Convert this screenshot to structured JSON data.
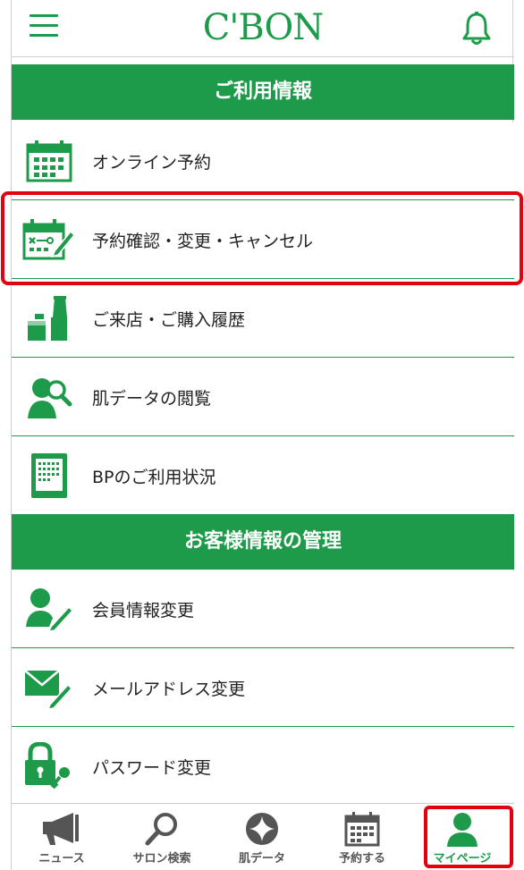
{
  "header": {
    "logo": "C'BON",
    "menu_icon": "hamburger-icon",
    "notification_icon": "bell-icon"
  },
  "sections": {
    "usage": {
      "title": "ご利用情報"
    },
    "customer": {
      "title": "お客様情報の管理"
    }
  },
  "usage_items": [
    {
      "label": "オンライン予約",
      "icon": "calendar-icon"
    },
    {
      "label": "予約確認・変更・キャンセル",
      "icon": "calendar-edit-icon"
    },
    {
      "label": "ご来店・ご購入履歴",
      "icon": "products-icon"
    },
    {
      "label": "肌データの閲覧",
      "icon": "person-magnifier-icon"
    },
    {
      "label": "BPのご利用状況",
      "icon": "tablet-icon"
    }
  ],
  "customer_items": [
    {
      "label": "会員情報変更",
      "icon": "person-edit-icon"
    },
    {
      "label": "メールアドレス変更",
      "icon": "mail-edit-icon"
    },
    {
      "label": "パスワード変更",
      "icon": "lock-key-icon"
    }
  ],
  "nav": [
    {
      "label": "ニュース",
      "icon": "megaphone-icon"
    },
    {
      "label": "サロン検索",
      "icon": "search-icon"
    },
    {
      "label": "肌データ",
      "icon": "sparkle-icon"
    },
    {
      "label": "予約する",
      "icon": "calendar-icon"
    },
    {
      "label": "マイページ",
      "icon": "person-icon"
    }
  ],
  "colors": {
    "brand": "#1e9b4a",
    "highlight": "#e3000f"
  }
}
